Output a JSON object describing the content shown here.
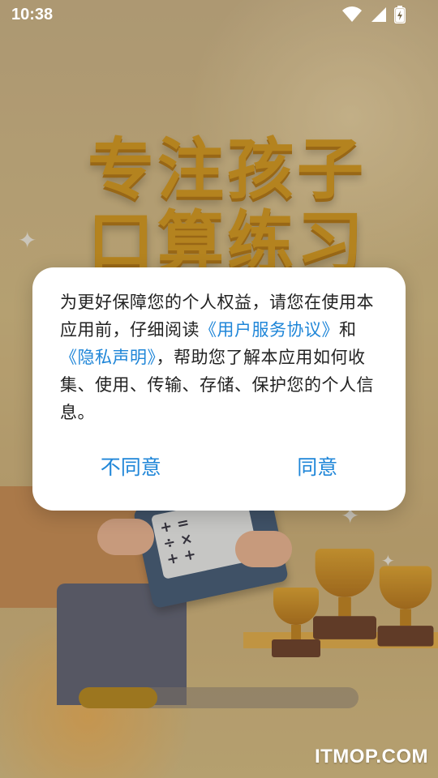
{
  "status_bar": {
    "time": "10:38",
    "icons": [
      "wifi-icon",
      "cellular-signal-icon",
      "battery-charging-icon"
    ]
  },
  "splash": {
    "headline_line1": "专注孩子",
    "headline_line2": "口算练习",
    "book_symbols": [
      "+ =",
      "÷ ×",
      "+ +"
    ],
    "loading_progress": 0.28,
    "colors": {
      "headline": "#d79a1f",
      "progress_fill": "#b88a1f",
      "progress_track": "#8c8278"
    }
  },
  "dialog": {
    "text_1": "为更好保障您的个人权益，请您在使用本应用前，仔细阅读",
    "link_user_agreement": "《用户服务协议》",
    "text_2": "和",
    "link_privacy_policy": "《隐私声明》",
    "text_3": "，帮助您了解本应用如何收集、使用、传输、存储、保护您的个人信息。",
    "disagree_label": "不同意",
    "agree_label": "同意",
    "link_color": "#1f86d8"
  },
  "watermark": "ITMOP.COM"
}
